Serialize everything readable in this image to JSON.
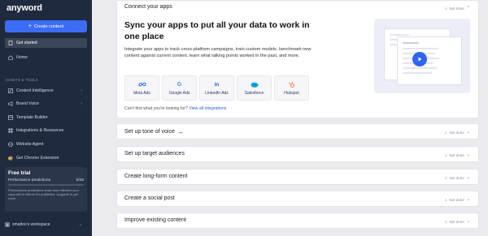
{
  "app": {
    "logo": "anyword"
  },
  "sidebar": {
    "create_label": "Create content",
    "items_top": [
      {
        "label": "Get started",
        "icon": "flag-icon",
        "active": true
      },
      {
        "label": "Home",
        "icon": "home-icon",
        "active": false
      }
    ],
    "section_label": "ASSETS & TOOLS",
    "items_tools": [
      {
        "label": "Content Intelligence",
        "icon": "chart-icon",
        "chevron": true
      },
      {
        "label": "Brand Voice",
        "icon": "megaphone-icon",
        "chevron": true
      },
      {
        "label": "Template Builder",
        "icon": "template-icon",
        "chevron": false
      },
      {
        "label": "Integrations & Resources",
        "icon": "grid-icon",
        "chevron": false
      },
      {
        "label": "Website Agent",
        "icon": "globe-icon",
        "chevron": false
      },
      {
        "label": "Get Chrome Extension",
        "icon": "chrome-icon",
        "chevron": false
      }
    ],
    "trial": {
      "title": "Free trial",
      "metric_label": "Performance predictions",
      "metric_value": "0/25",
      "progress": 0,
      "description": "Performance predictions show how effective your copy will be before it's published. Upgrade to get more."
    },
    "workspace": {
      "avatar": "S",
      "label": "smattoo's workspace"
    }
  },
  "main": {
    "connect": {
      "header": "Connect your apps",
      "status": "Not done",
      "title": "Sync your apps to put all your data to work in one place",
      "description": "Integrate your apps to track cross-platform campaigns, train custom models, benchmark new content against current content, learn what talking points worked in the past, and more.",
      "integrations": [
        {
          "label": "Meta Ads",
          "icon": "meta-icon"
        },
        {
          "label": "Google Ads",
          "icon": "google-icon"
        },
        {
          "label": "LinkedIn Ads",
          "icon": "linkedin-icon"
        },
        {
          "label": "Salesforce",
          "icon": "salesforce-icon"
        },
        {
          "label": "Hubspot",
          "icon": "hubspot-icon"
        }
      ],
      "find_text": "Can't find what you're looking for?",
      "find_link": "View all integrations"
    },
    "steps": [
      {
        "title": "Set up tone of voice",
        "arrow": true,
        "status": "Not done"
      },
      {
        "title": "Set up target audiences",
        "arrow": false,
        "status": "Not done"
      },
      {
        "title": "Create long-form content",
        "arrow": false,
        "status": "Not done"
      },
      {
        "title": "Create a social post",
        "arrow": false,
        "status": "Not done"
      },
      {
        "title": "Improve existing content",
        "arrow": false,
        "status": "Not done"
      }
    ]
  },
  "colors": {
    "sidebar_bg": "#1f2a3e",
    "accent": "#3d6df5",
    "link": "#2d5bd9"
  }
}
